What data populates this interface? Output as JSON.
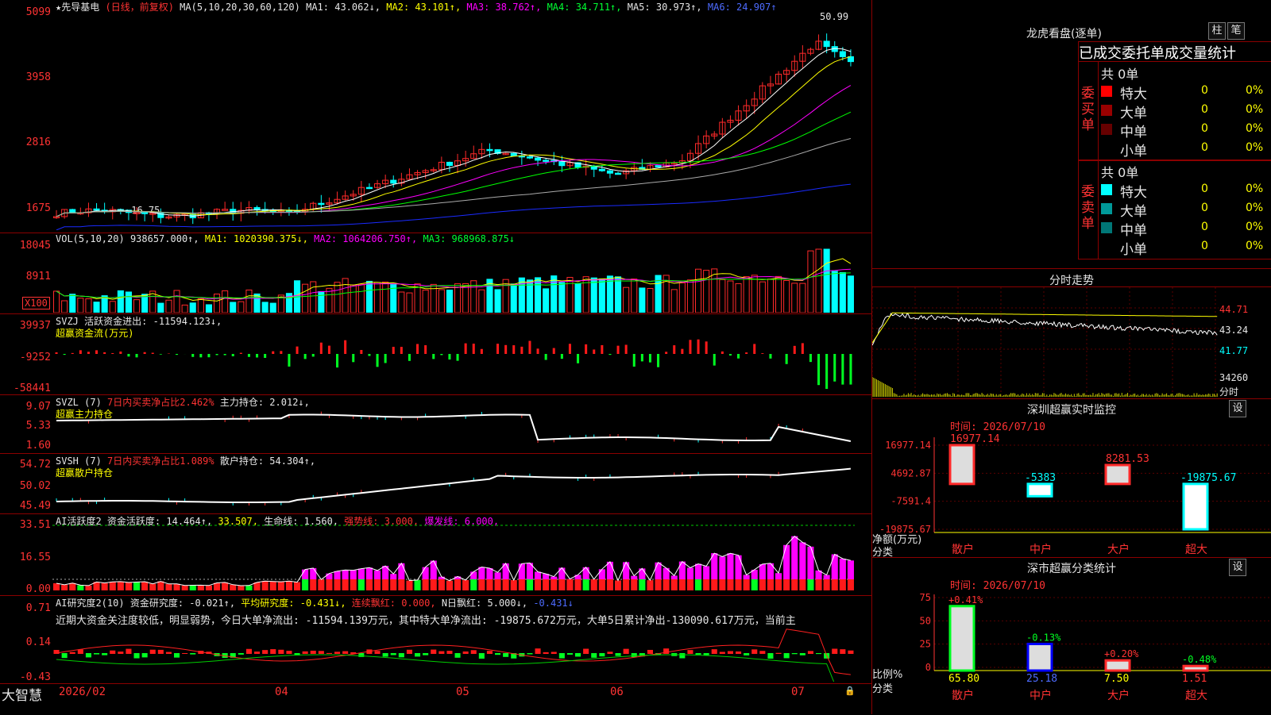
{
  "app": {
    "name": "大智慧",
    "date_labels": [
      "2026/02",
      "04",
      "05",
      "06",
      "07"
    ]
  },
  "kline": {
    "title": "★先导基电",
    "mode": "(日线，前复权)",
    "ma_params": "MA(5,10,20,30,60,120)",
    "ma1": "MA1: 43.062↓,",
    "ma2": "MA2: 43.101↑,",
    "ma3": "MA3: 38.762↑,",
    "ma4": "MA4: 34.711↑,",
    "ma5": "MA5: 30.973↑,",
    "ma6": "MA6: 24.907↑",
    "y_ticks": [
      "5099",
      "3958",
      "2816",
      "1675"
    ],
    "high_label": "50.99",
    "low_label": "←16.75",
    "colors": {
      "up": "#ff2a2a",
      "down": "#00ffff",
      "ma1": "#ffffff",
      "ma2": "#ffff00",
      "ma3": "#ff00ff",
      "ma4": "#00ff00",
      "ma5": "#aaaaaa",
      "ma6": "#1a2bff"
    }
  },
  "vol": {
    "title": "VOL(5,10,20)",
    "value": "938657.000↑,",
    "ma1": "MA1: 1020390.375↓,",
    "ma2": "MA2: 1064206.750↑,",
    "ma3": "MA3: 968968.875↓",
    "y_ticks": [
      "18045",
      "8911"
    ],
    "unit": "X100"
  },
  "svzj": {
    "title": "SVZJ",
    "label": "活跃资金进出: -11594.123↓,",
    "sub": "超赢资金流(万元)",
    "y_ticks": [
      "39937",
      "-9252",
      "-58441"
    ]
  },
  "svzl": {
    "title": "SVZL (7)",
    "ratio": "7日内买卖净占比2.462%",
    "hold": "主力持仓: 2.012↓,",
    "sub": "超赢主力持仓",
    "y_ticks": [
      "9.07",
      "5.33",
      "1.60"
    ]
  },
  "svsh": {
    "title": "SVSH (7)",
    "ratio": "7日内买卖净占比1.089%",
    "hold": "散户持仓: 54.304↑,",
    "sub": "超赢散户持仓",
    "y_ticks": [
      "54.72",
      "50.02",
      "45.49"
    ]
  },
  "ai_active": {
    "title": "AI活跃度2",
    "v1": "资金活跃度: 14.464↑,",
    "v2": "33.507,",
    "v3": "生命线: 1.560,",
    "v4": "强势线: 3.000,",
    "v5": "爆发线: 6.000,",
    "y_ticks": [
      "33.51",
      "16.55",
      "0.00"
    ]
  },
  "ai_research": {
    "title": "AI研究度2(10)",
    "v1": "资金研究度: -0.021↑,",
    "v2": "平均研究度: -0.431↓,",
    "v3": "连续飘红: 0.000,",
    "v4": "N日飘红: 5.000↓,",
    "v5": "-0.431↓",
    "comment": "近期大资金关注度较低，明显弱势，今日大单净流出: -11594.139万元，其中特大单净流出: -19875.672万元，大单5日累计净出-130090.617万元，当前主",
    "y_ticks": [
      "0.71",
      "0.14",
      "-0.43"
    ]
  },
  "dragon": {
    "title": "龙虎看盘(逐单)",
    "btn1": "柱",
    "btn2": "笔",
    "header": "已成交委托单成交量统计",
    "buy_label": "委买单",
    "sell_label": "委卖单",
    "buy_total": "共 0单",
    "sell_total": "共 0单",
    "buy_rows": [
      {
        "name": "特大",
        "count": "0",
        "pct": "0%",
        "color": "#ff0000"
      },
      {
        "name": "大单",
        "count": "0",
        "pct": "0%",
        "color": "#990000"
      },
      {
        "name": "中单",
        "count": "0",
        "pct": "0%",
        "color": "#660000"
      },
      {
        "name": "小单",
        "count": "0",
        "pct": "0%",
        "color": ""
      }
    ],
    "sell_rows": [
      {
        "name": "特大",
        "count": "0",
        "pct": "0%",
        "color": "#00ffff"
      },
      {
        "name": "大单",
        "count": "0",
        "pct": "0%",
        "color": "#009999"
      },
      {
        "name": "中单",
        "count": "0",
        "pct": "0%",
        "color": "#007777"
      },
      {
        "name": "小单",
        "count": "0",
        "pct": "0%",
        "color": ""
      }
    ]
  },
  "intraday": {
    "title": "分时走势",
    "prices": [
      "44.71",
      "43.24",
      "41.77"
    ],
    "vol": "34260",
    "unit": "分时"
  },
  "monitor": {
    "title": "深圳超赢实时监控",
    "btn": "设",
    "time": "时间: 2026/07/10",
    "y_ticks": [
      "16977.14",
      "4692.87",
      "-7591.4",
      "-19875.67"
    ],
    "axis_label": "净额(万元)",
    "axis_label2": "分类",
    "categories": [
      "散户",
      "中户",
      "大户",
      "超大"
    ],
    "values": [
      16977.14,
      -5383,
      8281.53,
      -19875.67
    ],
    "value_labels": [
      "16977.14",
      "-5383",
      "8281.53",
      "-19875.67"
    ]
  },
  "classify": {
    "title": "深市超赢分类统计",
    "btn": "设",
    "time": "时间: 2026/07/10",
    "y_ticks": [
      "75",
      "50",
      "25",
      "0"
    ],
    "axis_label": "比例%",
    "axis_label2": "分类",
    "categories": [
      "散户",
      "中户",
      "大户",
      "超大"
    ],
    "values": [
      65.8,
      25.18,
      7.5,
      1.51
    ],
    "value_labels": [
      "65.80",
      "25.18",
      "7.50",
      "1.51"
    ],
    "change_labels": [
      "+0.41%",
      "-0.13%",
      "+0.20%",
      "-0.48%"
    ]
  }
}
